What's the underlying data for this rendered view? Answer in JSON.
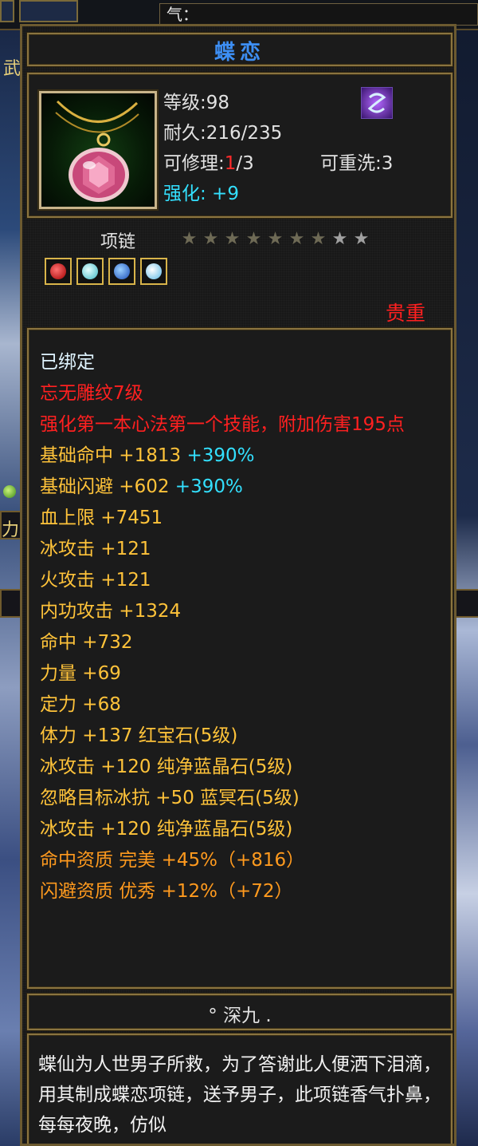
{
  "hud": {
    "qi_label": "气：",
    "side_char_1": "武",
    "side_char_2": "力"
  },
  "item": {
    "name": "蝶恋",
    "level": "等级:98",
    "durability": "耐久:216/235",
    "repair_prefix": "可修理:",
    "repair_current": "1",
    "repair_suffix": "/3",
    "rewash": "可重洗:3",
    "strengthen": "强化: +9",
    "type": "项链",
    "stars_on": 7,
    "stars_total": 9,
    "value_tag": "贵重",
    "gems": [
      "red-gem",
      "cyan-gem",
      "blue-gem",
      "sky-gem"
    ]
  },
  "stats": {
    "bound": "已绑定",
    "engrave": "忘无雕纹7级",
    "skill_bonus": "强化第一本心法第一个技能，附加伤害195点",
    "base_hit_label": "基础命中 +1813",
    "base_hit_pct": "+390%",
    "base_dodge_label": "基础闪避 +602",
    "base_dodge_pct": "+390%",
    "hp": "血上限 +7451",
    "ice_atk": "冰攻击 +121",
    "fire_atk": "火攻击 +121",
    "inner_atk": "内功攻击 +1324",
    "hit": "命中 +732",
    "strength": "力量 +69",
    "focus": "定力 +68",
    "stamina_gem": "体力 +137 红宝石(5级)",
    "ice_gem_1": "冰攻击 +120 纯净蓝晶石(5级)",
    "ignore_ice_gem": "忽略目标冰抗 +50 蓝冥石(5级)",
    "ice_gem_2": "冰攻击 +120 纯净蓝晶石(5级)",
    "hit_quality": "命中资质  完美 +45%（+816）",
    "dodge_quality": "闪避资质  优秀 +12%（+72）"
  },
  "footer": {
    "author": "° 深九 .",
    "description": "蝶仙为人世男子所救，为了答谢此人便洒下泪滴，用其制成蝶恋项链，送予男子，此项链香气扑鼻，每每夜晚，仿似"
  },
  "colors": {
    "title_blue": "#3d8ff5",
    "gold_text": "#ffc33a",
    "red_text": "#ff2020",
    "cyan_text": "#33e0ff",
    "orange_text": "#ff9a1e",
    "frame_gold": "#8a7440"
  }
}
